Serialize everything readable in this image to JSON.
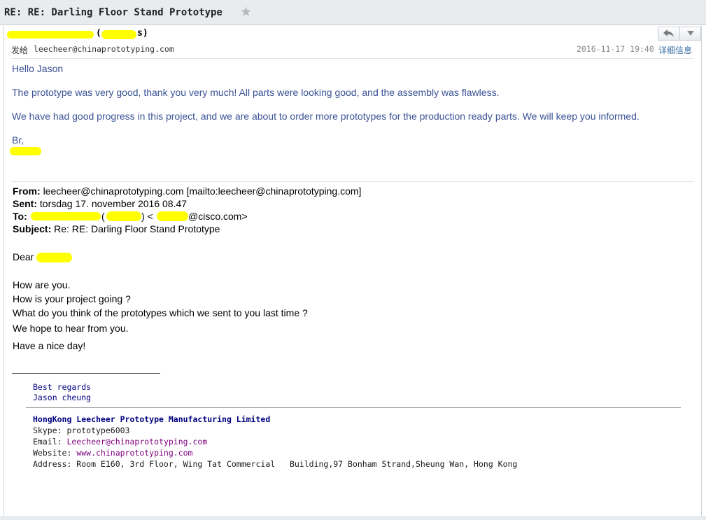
{
  "window": {
    "title": "RE: RE: Darling Floor Stand Prototype"
  },
  "toolbar": {
    "reply_icon": "reply-arrow-icon",
    "menu_icon": "chevron-down-icon"
  },
  "header": {
    "sender_suffix": "(          s)",
    "from_label": "发给",
    "from_address": "leecheer@chinaprototyping.com",
    "date": "2016-11-17 19:40",
    "details_link": "详细信息"
  },
  "message": {
    "greeting": "Hello Jason",
    "para1": "The prototype was very good, thank you very much! All parts were looking good, and the assembly was flawless.",
    "para2": "We have had good progress in this project, and we are about to order more prototypes for the production ready parts. We will keep you informed.",
    "closing": "Br,"
  },
  "quoted": {
    "from_label": "From:",
    "from_value": "leecheer@chinaprototyping.com [mailto:leecheer@chinaprototyping.com]",
    "sent_label": "Sent:",
    "sent_value": "torsdag 17. november 2016 08.47",
    "to_label": "To:",
    "to_value": "@cisco.com>",
    "to_open": "(",
    "to_mid": ") <",
    "subject_label": "Subject:",
    "subject_value": "Re: RE: Darling Floor Stand Prototype",
    "dear": "Dear",
    "lines": [
      "How are you.",
      "How is your project going ?",
      "What do you think of the prototypes which we sent to you last time ?",
      "We hope to hear from you.",
      "Have a nice day!"
    ]
  },
  "signature": {
    "regards": "Best regards",
    "name": "Jason cheung",
    "company": "HongKong Leecheer Prototype Manufacturing Limited",
    "skype": "Skype: prototype6003",
    "email_label": "Email: ",
    "email": "Leecheer@chinaprototyping.com",
    "website_label": "Website: ",
    "website": "www.chinaprototyping.com",
    "address": "Address: Room E160, 3rd Floor, Wing Tat Commercial   Building,97 Bonham Strand,Sheung Wan, Hong Kong"
  }
}
